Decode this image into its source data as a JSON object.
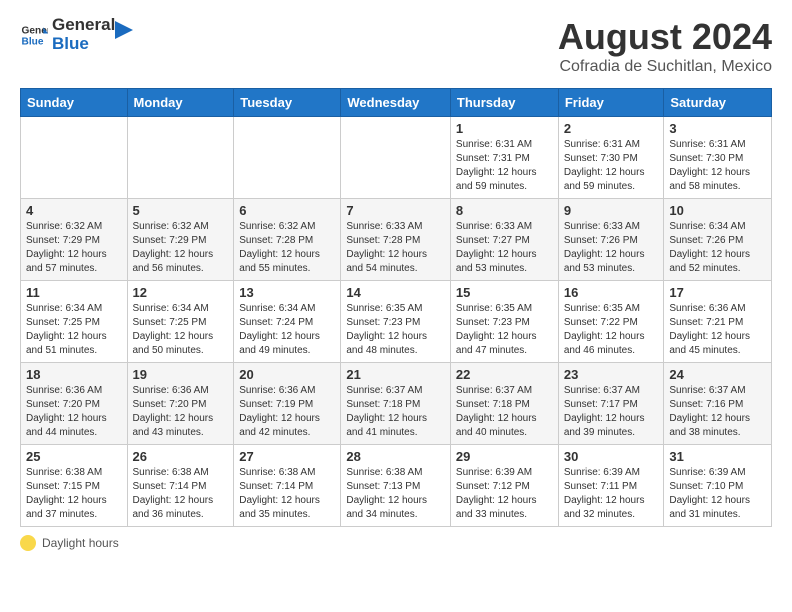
{
  "header": {
    "logo_general": "General",
    "logo_blue": "Blue",
    "main_title": "August 2024",
    "subtitle": "Cofradia de Suchitlan, Mexico"
  },
  "calendar": {
    "days_of_week": [
      "Sunday",
      "Monday",
      "Tuesday",
      "Wednesday",
      "Thursday",
      "Friday",
      "Saturday"
    ],
    "weeks": [
      [
        {
          "day": "",
          "info": ""
        },
        {
          "day": "",
          "info": ""
        },
        {
          "day": "",
          "info": ""
        },
        {
          "day": "",
          "info": ""
        },
        {
          "day": "1",
          "info": "Sunrise: 6:31 AM\nSunset: 7:31 PM\nDaylight: 12 hours and 59 minutes."
        },
        {
          "day": "2",
          "info": "Sunrise: 6:31 AM\nSunset: 7:30 PM\nDaylight: 12 hours and 59 minutes."
        },
        {
          "day": "3",
          "info": "Sunrise: 6:31 AM\nSunset: 7:30 PM\nDaylight: 12 hours and 58 minutes."
        }
      ],
      [
        {
          "day": "4",
          "info": "Sunrise: 6:32 AM\nSunset: 7:29 PM\nDaylight: 12 hours and 57 minutes."
        },
        {
          "day": "5",
          "info": "Sunrise: 6:32 AM\nSunset: 7:29 PM\nDaylight: 12 hours and 56 minutes."
        },
        {
          "day": "6",
          "info": "Sunrise: 6:32 AM\nSunset: 7:28 PM\nDaylight: 12 hours and 55 minutes."
        },
        {
          "day": "7",
          "info": "Sunrise: 6:33 AM\nSunset: 7:28 PM\nDaylight: 12 hours and 54 minutes."
        },
        {
          "day": "8",
          "info": "Sunrise: 6:33 AM\nSunset: 7:27 PM\nDaylight: 12 hours and 53 minutes."
        },
        {
          "day": "9",
          "info": "Sunrise: 6:33 AM\nSunset: 7:26 PM\nDaylight: 12 hours and 53 minutes."
        },
        {
          "day": "10",
          "info": "Sunrise: 6:34 AM\nSunset: 7:26 PM\nDaylight: 12 hours and 52 minutes."
        }
      ],
      [
        {
          "day": "11",
          "info": "Sunrise: 6:34 AM\nSunset: 7:25 PM\nDaylight: 12 hours and 51 minutes."
        },
        {
          "day": "12",
          "info": "Sunrise: 6:34 AM\nSunset: 7:25 PM\nDaylight: 12 hours and 50 minutes."
        },
        {
          "day": "13",
          "info": "Sunrise: 6:34 AM\nSunset: 7:24 PM\nDaylight: 12 hours and 49 minutes."
        },
        {
          "day": "14",
          "info": "Sunrise: 6:35 AM\nSunset: 7:23 PM\nDaylight: 12 hours and 48 minutes."
        },
        {
          "day": "15",
          "info": "Sunrise: 6:35 AM\nSunset: 7:23 PM\nDaylight: 12 hours and 47 minutes."
        },
        {
          "day": "16",
          "info": "Sunrise: 6:35 AM\nSunset: 7:22 PM\nDaylight: 12 hours and 46 minutes."
        },
        {
          "day": "17",
          "info": "Sunrise: 6:36 AM\nSunset: 7:21 PM\nDaylight: 12 hours and 45 minutes."
        }
      ],
      [
        {
          "day": "18",
          "info": "Sunrise: 6:36 AM\nSunset: 7:20 PM\nDaylight: 12 hours and 44 minutes."
        },
        {
          "day": "19",
          "info": "Sunrise: 6:36 AM\nSunset: 7:20 PM\nDaylight: 12 hours and 43 minutes."
        },
        {
          "day": "20",
          "info": "Sunrise: 6:36 AM\nSunset: 7:19 PM\nDaylight: 12 hours and 42 minutes."
        },
        {
          "day": "21",
          "info": "Sunrise: 6:37 AM\nSunset: 7:18 PM\nDaylight: 12 hours and 41 minutes."
        },
        {
          "day": "22",
          "info": "Sunrise: 6:37 AM\nSunset: 7:18 PM\nDaylight: 12 hours and 40 minutes."
        },
        {
          "day": "23",
          "info": "Sunrise: 6:37 AM\nSunset: 7:17 PM\nDaylight: 12 hours and 39 minutes."
        },
        {
          "day": "24",
          "info": "Sunrise: 6:37 AM\nSunset: 7:16 PM\nDaylight: 12 hours and 38 minutes."
        }
      ],
      [
        {
          "day": "25",
          "info": "Sunrise: 6:38 AM\nSunset: 7:15 PM\nDaylight: 12 hours and 37 minutes."
        },
        {
          "day": "26",
          "info": "Sunrise: 6:38 AM\nSunset: 7:14 PM\nDaylight: 12 hours and 36 minutes."
        },
        {
          "day": "27",
          "info": "Sunrise: 6:38 AM\nSunset: 7:14 PM\nDaylight: 12 hours and 35 minutes."
        },
        {
          "day": "28",
          "info": "Sunrise: 6:38 AM\nSunset: 7:13 PM\nDaylight: 12 hours and 34 minutes."
        },
        {
          "day": "29",
          "info": "Sunrise: 6:39 AM\nSunset: 7:12 PM\nDaylight: 12 hours and 33 minutes."
        },
        {
          "day": "30",
          "info": "Sunrise: 6:39 AM\nSunset: 7:11 PM\nDaylight: 12 hours and 32 minutes."
        },
        {
          "day": "31",
          "info": "Sunrise: 6:39 AM\nSunset: 7:10 PM\nDaylight: 12 hours and 31 minutes."
        }
      ]
    ]
  },
  "footer": {
    "legend_label": "Daylight hours"
  }
}
